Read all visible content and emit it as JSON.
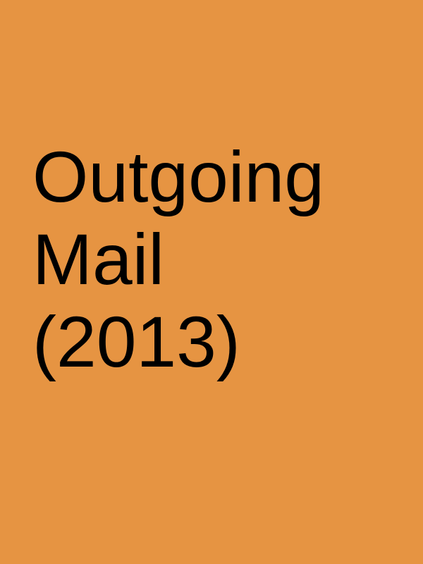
{
  "poster": {
    "background_color": "#e69442",
    "text_color": "#000000",
    "title_lines": [
      "Outgoing",
      "Mail",
      "(2013)"
    ]
  }
}
